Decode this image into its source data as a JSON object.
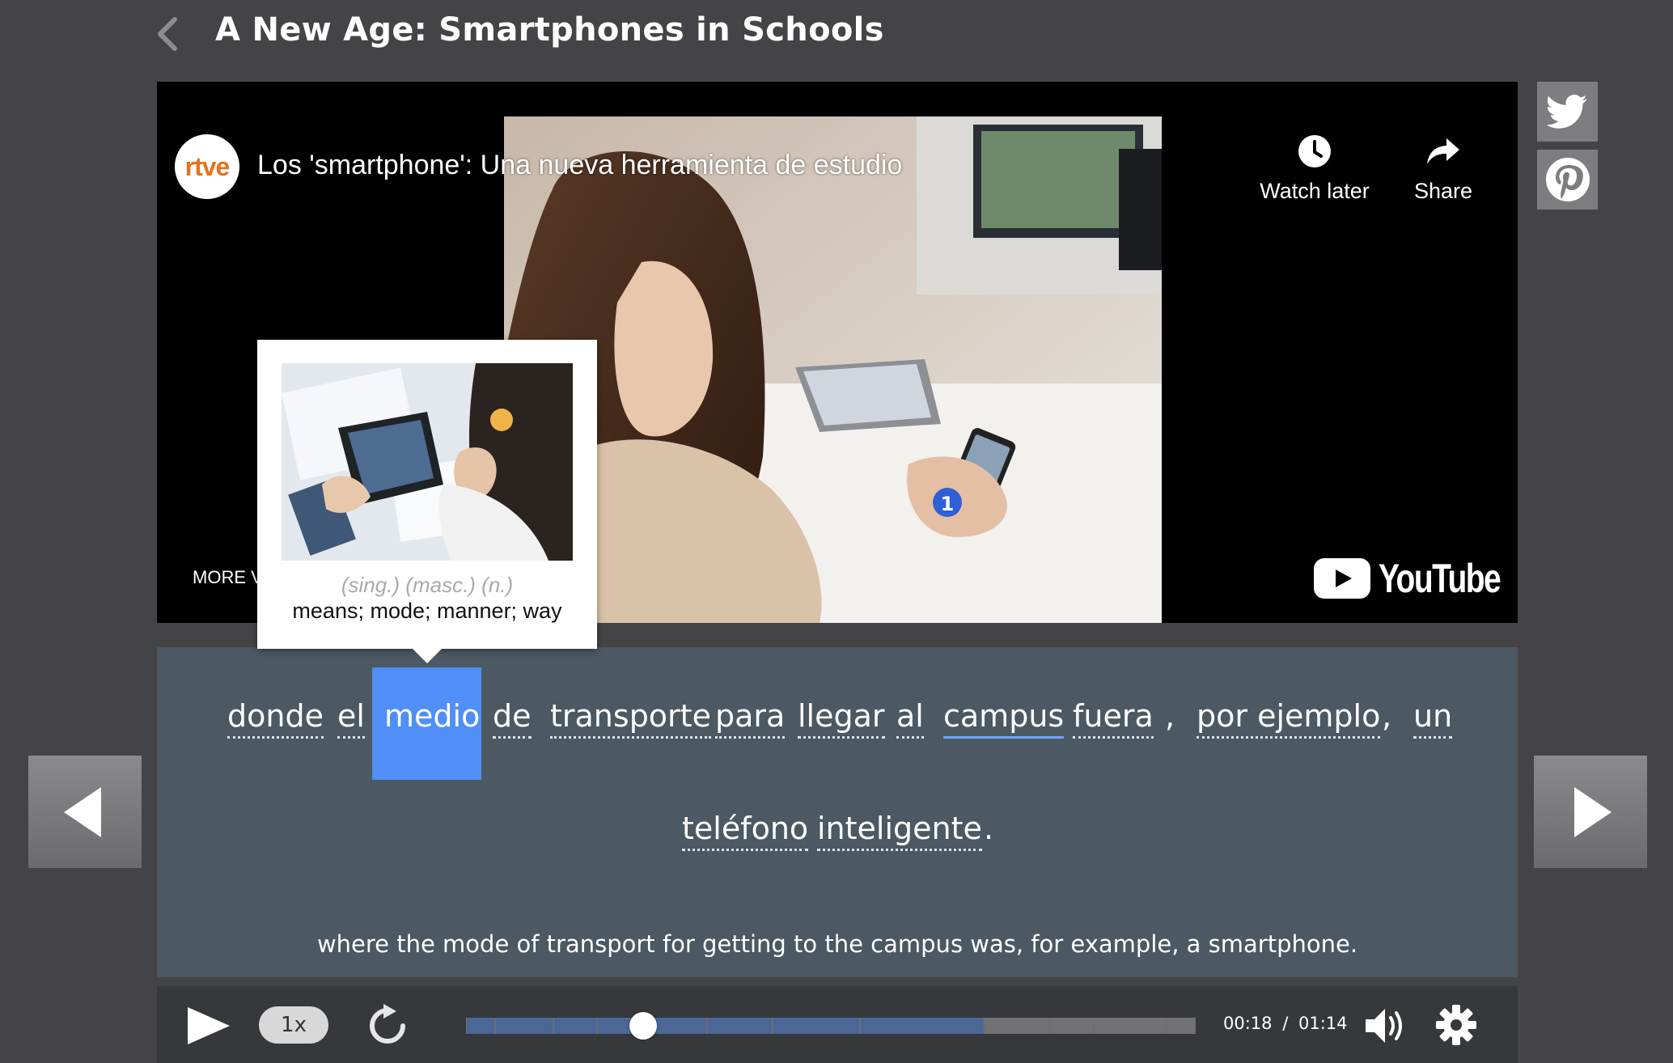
{
  "page": {
    "title": "A New Age: Smartphones in Schools"
  },
  "video": {
    "channel_logo_text": "rtve",
    "title": "Los 'smartphone': Una nueva herramienta de estudio",
    "watch_later_label": "Watch later",
    "share_label": "Share",
    "more_videos_label": "MORE V",
    "youtube_label": "YouTube",
    "channel_badge": "1"
  },
  "popup": {
    "grammar": "(sing.) (masc.) (n.)",
    "definition": "means; mode; manner; way"
  },
  "subtitle": {
    "line1": [
      {
        "text": "donde",
        "kind": "word"
      },
      {
        "text": "el",
        "kind": "word"
      },
      {
        "text": "medio",
        "kind": "word",
        "selected": true
      },
      {
        "text": "de",
        "kind": "word"
      },
      {
        "text": "transporte",
        "kind": "word"
      },
      {
        "text": "para",
        "kind": "word"
      },
      {
        "text": "llegar",
        "kind": "word"
      },
      {
        "text": "al",
        "kind": "word"
      },
      {
        "text": "campus",
        "kind": "word"
      },
      {
        "text": "fuera",
        "kind": "word"
      },
      {
        "text": ",",
        "kind": "punct"
      },
      {
        "text": "por ejemplo",
        "kind": "word"
      },
      {
        "text": ",",
        "kind": "punct"
      },
      {
        "text": "un",
        "kind": "word"
      }
    ],
    "line2": [
      {
        "text": "teléfono",
        "kind": "word"
      },
      {
        "text": "inteligente",
        "kind": "word"
      },
      {
        "text": ".",
        "kind": "punct"
      }
    ],
    "translation": "where the mode of transport for getting to the campus was, for example, a smartphone."
  },
  "controls": {
    "speed_label": "1x",
    "current_time": "00:18",
    "separator": "/",
    "total_time": "01:14",
    "progress": 0.243
  },
  "colors": {
    "background": "#444446",
    "subtitle_panel": "#4c5862",
    "highlight": "#4f8ff7",
    "progress_segment": "#4a6796"
  },
  "icons": {
    "back": "chevron-left-icon",
    "twitter": "twitter-icon",
    "pinterest": "pinterest-icon",
    "watch_later": "clock-icon",
    "share": "share-arrow-icon",
    "prev": "triangle-left-icon",
    "next": "triangle-right-icon",
    "play": "play-icon",
    "replay": "replay-icon",
    "volume": "volume-icon",
    "settings": "gear-icon"
  }
}
